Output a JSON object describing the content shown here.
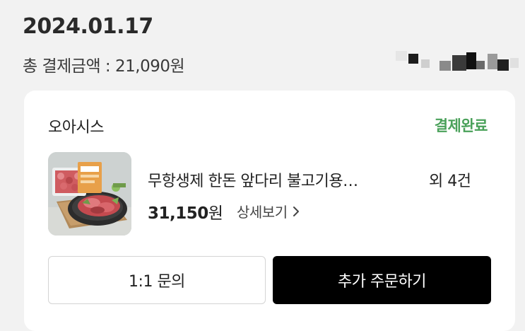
{
  "order": {
    "date": "2024.01.17",
    "total_label": "총 결제금액",
    "total_separator": " : ",
    "total_amount": "21,090원"
  },
  "card": {
    "store_name": "오아시스",
    "status": "결제완료",
    "product_name": "무항생제 한돈 앞다리 불고기용…",
    "item_count": "외 4건",
    "price_number": "31,150",
    "price_unit": "원",
    "detail_label": "상세보기"
  },
  "buttons": {
    "inquiry_label": "1:1 문의",
    "reorder_label": "추가 주문하기"
  },
  "colors": {
    "status_green": "#4aa15a",
    "reorder_bg": "#000000",
    "page_bg": "#f2f2f2"
  },
  "icons": {
    "detail_chevron": "chevron-right-icon"
  }
}
